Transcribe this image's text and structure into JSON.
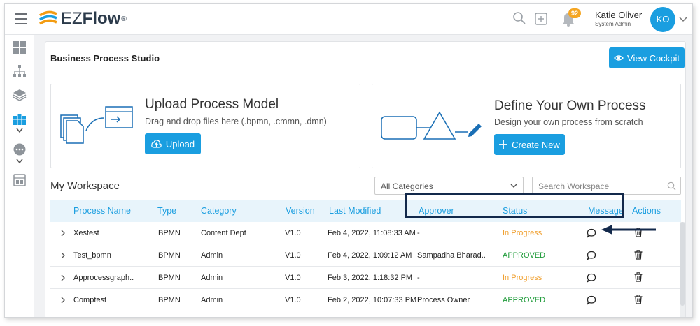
{
  "app": {
    "logo_text": "EZFlow",
    "logo_ez": "EZ",
    "logo_flow": "Flow",
    "logo_reg": "®"
  },
  "topbar": {
    "notification_count": "92",
    "user_name": "Katie Oliver",
    "user_role": "System Admin",
    "avatar_initials": "KO"
  },
  "sidebar": {
    "icons": [
      "dashboard-icon",
      "hierarchy-icon",
      "layers-icon",
      "process-studio-icon",
      "chat-icon",
      "report-icon"
    ]
  },
  "page": {
    "title": "Business Process Studio",
    "view_cockpit_label": "View Cockpit"
  },
  "upload_panel": {
    "title": "Upload Process Model",
    "subtitle": "Drag and drop files here (.bpmn, .cmmn, .dmn)",
    "button_label": "Upload"
  },
  "define_panel": {
    "title": "Define Your Own Process",
    "subtitle": "Design your own process from scratch",
    "button_label": "Create New"
  },
  "workspace": {
    "title": "My Workspace",
    "category_selected": "All Categories",
    "search_placeholder": "Search Workspace"
  },
  "table": {
    "headers": {
      "name": "Process Name",
      "type": "Type",
      "category": "Category",
      "version": "Version",
      "modified": "Last Modified",
      "approver": "Approver",
      "status": "Status",
      "message": "Message",
      "actions": "Actions"
    },
    "rows": [
      {
        "name": "Xestest",
        "type": "BPMN",
        "category": "Content Dept",
        "version": "V1.0",
        "modified": "Feb 4, 2022, 11:08:33 AM",
        "approver": "-",
        "status": "In Progress"
      },
      {
        "name": "Test_bpmn",
        "type": "BPMN",
        "category": "Admin",
        "version": "V1.0",
        "modified": "Feb 4, 2022, 1:09:12 AM",
        "approver": "Sampadha Bharad..",
        "status": "APPROVED"
      },
      {
        "name": "Approcessgraph..",
        "type": "BPMN",
        "category": "Admin",
        "version": "V1.0",
        "modified": "Feb 3, 2022, 1:18:32 PM",
        "approver": "-",
        "status": "In Progress"
      },
      {
        "name": "Comptest",
        "type": "BPMN",
        "category": "Admin",
        "version": "V1.0",
        "modified": "Feb 2, 2022, 10:07:33 PM",
        "approver": "Process Owner",
        "status": "APPROVED"
      }
    ]
  },
  "colors": {
    "accent": "#1a9ee0",
    "in_progress": "#f0a030",
    "approved": "#1f9b3a",
    "annotation": "#13294b",
    "badge": "#f5a623"
  }
}
